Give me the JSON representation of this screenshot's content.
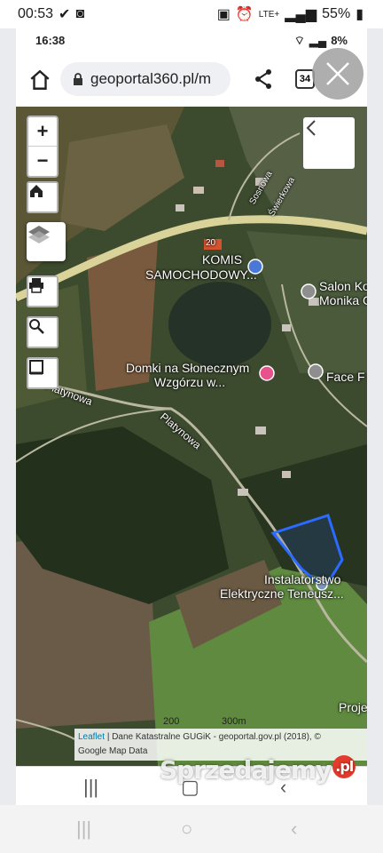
{
  "outer_status": {
    "time": "00:53",
    "battery": "55%",
    "network": "LTE+"
  },
  "inner_status": {
    "time": "16:38",
    "battery": "8%"
  },
  "browser": {
    "url": "geoportal360.pl/m",
    "tab_count": "34"
  },
  "map": {
    "labels": {
      "road_number": "20",
      "street_sosnowa": "Sosnowa",
      "street_swierkowa": "Świerkowa",
      "poi_komis_1": "KOMIS",
      "poi_komis_2": "SAMOCHODOWY...",
      "poi_salon_1": "Salon Ko",
      "poi_salon_2": "Monika G",
      "poi_domki_1": "Domki na Słonecznym",
      "poi_domki_2": "Wzgórzu w...",
      "poi_face": "Face F",
      "street_platynowa_1": "Platynowa",
      "street_platynowa_2": "Platynowa",
      "poi_instal_1": "Instalatorstwo",
      "poi_instal_2": "Elektryczne Teneusz...",
      "poi_proje": "Proje"
    },
    "scale": {
      "m": "200",
      "mi": "300m"
    },
    "attribution": {
      "leaflet": "Leaflet",
      "rest": "| Dane Katastralne GUGiK - geoportal.gov.pl (2018), ©",
      "line2": "Google Map Data"
    },
    "controls": {
      "zoom_in": "+",
      "zoom_out": "−"
    }
  },
  "watermark": {
    "text": "Sprzedajemy",
    "badge": ".pl"
  }
}
